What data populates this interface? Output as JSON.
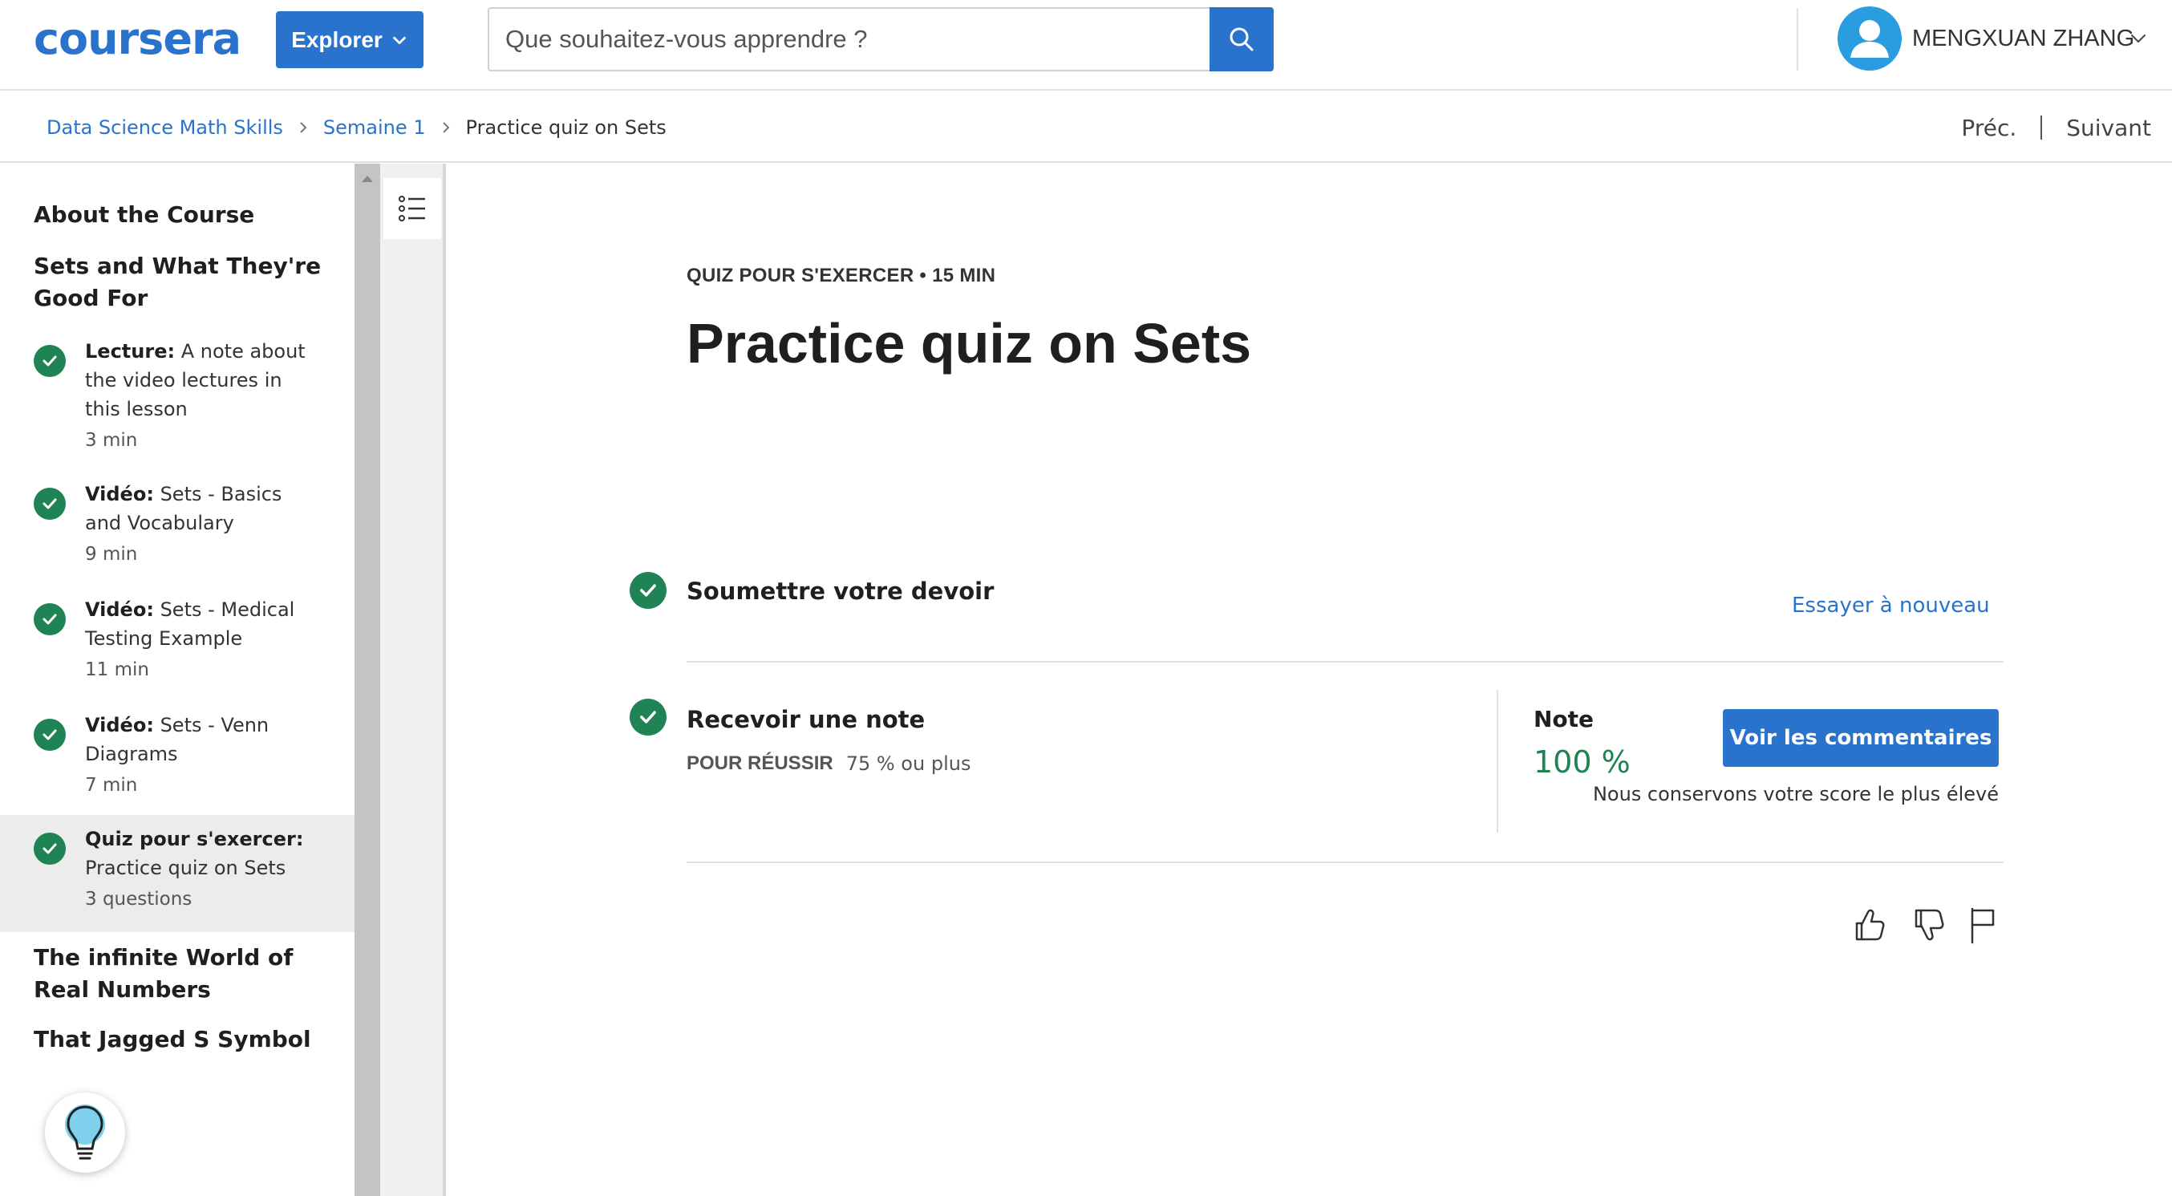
{
  "header": {
    "logo_text": "coursera",
    "explore_label": "Explorer",
    "search_placeholder": "Que souhaitez-vous apprendre ?",
    "user_name": "MENGXUAN ZHANG"
  },
  "breadcrumb": {
    "items": [
      "Data Science Math Skills",
      "Semaine 1",
      "Practice quiz on Sets"
    ],
    "prev_label": "Préc.",
    "next_label": "Suivant"
  },
  "sidebar": {
    "sections": [
      "About the Course",
      "Sets and What They're Good For",
      "The infinite World of Real Numbers",
      "That Jagged S Symbol"
    ],
    "items": [
      {
        "type": "Lecture:",
        "title": "A note about the video lectures in this lesson",
        "meta": "3  min",
        "completed": true
      },
      {
        "type": "Vidéo:",
        "title": "Sets - Basics and Vocabulary",
        "meta": "9  min",
        "completed": true
      },
      {
        "type": "Vidéo:",
        "title": "Sets - Medical Testing Example",
        "meta": "11  min",
        "completed": true
      },
      {
        "type": "Vidéo:",
        "title": "Sets - Venn Diagrams",
        "meta": "7  min",
        "completed": true
      },
      {
        "type": "Quiz pour s'exercer:",
        "title": "Practice quiz on Sets",
        "meta": "3 questions",
        "completed": true,
        "active": true
      }
    ]
  },
  "main": {
    "meta": "QUIZ POUR S'EXERCER • 15  MIN",
    "title": "Practice quiz on Sets",
    "submit": {
      "title": "Soumettre votre devoir",
      "retry_label": "Essayer à nouveau"
    },
    "grade": {
      "title": "Recevoir une note",
      "pass_label": "POUR RÉUSSIR",
      "pass_value": "75 % ou plus",
      "note_label": "Note",
      "note_value": "100 %",
      "comments_label": "Voir les commentaires",
      "keep_note": "Nous conservons votre score le plus élevé"
    }
  },
  "colors": {
    "brand_blue": "#2a73cc",
    "success_green": "#1f8354",
    "active_bg": "#ececec"
  },
  "icons": [
    "search-icon",
    "chevron-down-icon",
    "user-avatar-icon",
    "chevron-right-icon",
    "checkmark-icon",
    "list-outline-icon",
    "lightbulb-icon",
    "thumbs-up-icon",
    "thumbs-down-icon",
    "flag-icon"
  ]
}
